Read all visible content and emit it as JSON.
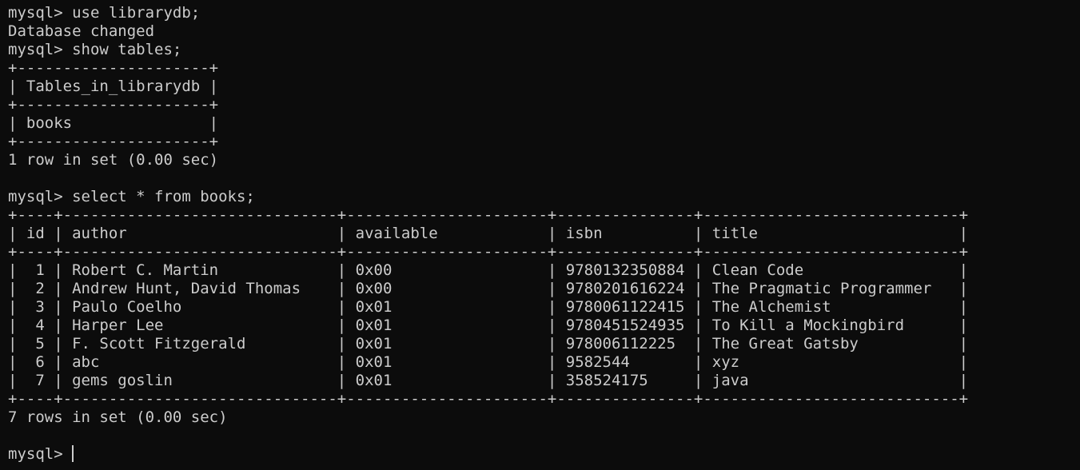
{
  "terminal": {
    "lines": [
      "mysql> use librarydb;",
      "Database changed",
      "mysql> show tables;",
      "+---------------------+",
      "| Tables_in_librarydb |",
      "+---------------------+",
      "| books               |",
      "+---------------------+",
      "1 row in set (0.00 sec)",
      "",
      "mysql> select * from books;",
      "+----+------------------------------+----------------------+---------------+----------------------------+",
      "| id | author                       | available            | isbn          | title                      |",
      "+----+------------------------------+----------------------+---------------+----------------------------+",
      "|  1 | Robert C. Martin             | 0x00                 | 9780132350884 | Clean Code                 |",
      "|  2 | Andrew Hunt, David Thomas    | 0x00                 | 9780201616224 | The Pragmatic Programmer   |",
      "|  3 | Paulo Coelho                 | 0x01                 | 9780061122415 | The Alchemist              |",
      "|  4 | Harper Lee                   | 0x01                 | 9780451524935 | To Kill a Mockingbird      |",
      "|  5 | F. Scott Fitzgerald          | 0x01                 | 978006112225  | The Great Gatsby           |",
      "|  6 | abc                          | 0x01                 | 9582544       | xyz                        |",
      "|  7 | gems goslin                  | 0x01                 | 358524175     | java                       |",
      "+----+------------------------------+----------------------+---------------+----------------------------+",
      "7 rows in set (0.00 sec)",
      ""
    ],
    "prompt": "mysql> "
  },
  "colors": {
    "background": "#0c0c0c",
    "foreground": "#cccccc"
  }
}
